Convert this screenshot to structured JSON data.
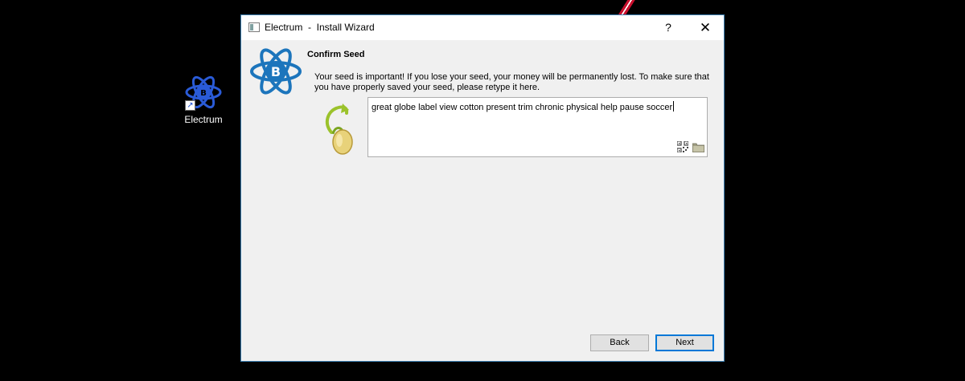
{
  "desktop": {
    "icon_label": "Electrum"
  },
  "window": {
    "title": "Electrum  -  Install Wizard",
    "help_label": "?",
    "close_label": "✕"
  },
  "wizard": {
    "heading": "Confirm Seed",
    "message": "Your seed is important! If you lose your seed, your money will be permanently lost. To make sure that you have properly saved your seed, please retype it here.",
    "seed_value": "great globe label view cotton present trim chronic physical help pause soccer"
  },
  "buttons": {
    "back_label": "Back",
    "next_label": "Next"
  },
  "colors": {
    "logo_blue": "#1c75bc",
    "accent": "#0078d7",
    "desktop_bg": "#000000"
  }
}
